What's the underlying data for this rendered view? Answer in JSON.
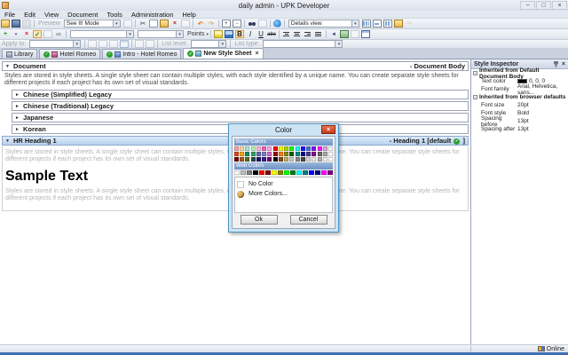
{
  "glyphs": {
    "collapse": "▼",
    "expand": "►",
    "dropdown": "▾",
    "close": "×",
    "check": "✓",
    "minimize": "−",
    "maximize": "□",
    "minus": "−",
    "plus": "+",
    "x_red": "×",
    "undo": "↶",
    "redo": "↷",
    "expand_box": "+",
    "collapse_box": "−"
  },
  "window": {
    "title": "daily admin - UPK Developer"
  },
  "menu": {
    "items": [
      "File",
      "Edit",
      "View",
      "Document",
      "Tools",
      "Administration",
      "Help"
    ]
  },
  "toolbar": {
    "preview_label": "Preview",
    "mode_value": "See It! Mode",
    "view_value": "Details view",
    "points_value": "Points",
    "bold_label": "B",
    "italic_label": "I",
    "underline_label": "U",
    "strike_label": "abc",
    "apply_to_label": "Apply to:",
    "list_level_label": "List level:",
    "list_type_label": "List type:"
  },
  "tabs": [
    {
      "label": "Library"
    },
    {
      "label": "Hotel Romeo"
    },
    {
      "label": "Intro - Hotel Romeo"
    },
    {
      "label": "New Style Sheet"
    }
  ],
  "editor": {
    "document_title": "Document",
    "document_style": "- Document Body",
    "body_text": "Styles are stored in style sheets. A single style sheet can contain multiple styles, with each style identified by a unique name. You can create separate style sheets for different projects if each project has its own set of visual standards.",
    "collapsed_sections": [
      "Chinese (Simplified) Legacy",
      "Chinese (Traditional) Legacy",
      "Japanese",
      "Korean"
    ],
    "heading_title": "HR Heading 1",
    "heading_style_prefix": "- Heading 1 [default",
    "heading_style_suffix": "]",
    "sample_text": "Sample Text"
  },
  "inspector": {
    "title": "Style Inspector",
    "group1_label": "Inherited from Default Document Body",
    "group2_label": "Inherited from browser defaults",
    "rows": {
      "text_color_name": "Text color",
      "text_color_value": "0, 0, 0",
      "text_color_swatch": "#000000",
      "font_family_name": "Font family",
      "font_family_value": "Arial, Helvetica, sans...",
      "font_size_name": "Font size",
      "font_size_value": "20pt",
      "font_style_name": "Font style",
      "font_style_value": "Bold",
      "spacing_before_name": "Spacing before",
      "spacing_before_value": "13pt",
      "spacing_after_name": "Spacing after",
      "spacing_after_value": "13pt"
    }
  },
  "dialog": {
    "title": "Color",
    "basic_label": "Basic Colors",
    "web_label": "Web Colors",
    "no_color_label": "No Color",
    "more_colors_label": "More Colors...",
    "ok_label": "Ok",
    "cancel_label": "Cancel",
    "basic_colors": [
      [
        "#F4A8A8",
        "#F8D8A8",
        "#A8E8D8",
        "#B8F0B0",
        "#F8B8D8",
        "#F060C0",
        "#F8A8E8",
        "#F80808",
        "#F8F800",
        "#A8D800",
        "#18F818",
        "#18F8F8",
        "#1818F8",
        "#4868E0",
        "#8018E8",
        "#F818F8",
        "#D8A8E0",
        "#F8F8F8"
      ],
      [
        "#E04818",
        "#F8A818",
        "#188868",
        "#30A060",
        "#5870A8",
        "#8078C8",
        "#D868C8",
        "#901008",
        "#F87818",
        "#888800",
        "#086008",
        "#088888",
        "#080888",
        "#483898",
        "#880888",
        "#686868",
        "#A8A8A8",
        "#FFFFFF"
      ],
      [
        "#700808",
        "#A85820",
        "#587018",
        "#284858",
        "#181860",
        "#381890",
        "#700868",
        "#080808",
        "#884818",
        "#B8B068",
        "#C8C8C8",
        "#888888",
        "#484848",
        "#D8D8D8",
        "#E8E8E8",
        "#B0B0B0",
        "#F0F0F0",
        "#FFFFFF"
      ]
    ],
    "web_colors": [
      "#FFFFFF",
      "#C0C0C0",
      "#808080",
      "#000000",
      "#FF0000",
      "#800000",
      "#FFFF00",
      "#808000",
      "#00FF00",
      "#008000",
      "#00FFFF",
      "#008080",
      "#0000FF",
      "#000080",
      "#FF00FF",
      "#800080"
    ]
  },
  "statusbar": {
    "online_label": "Online"
  }
}
